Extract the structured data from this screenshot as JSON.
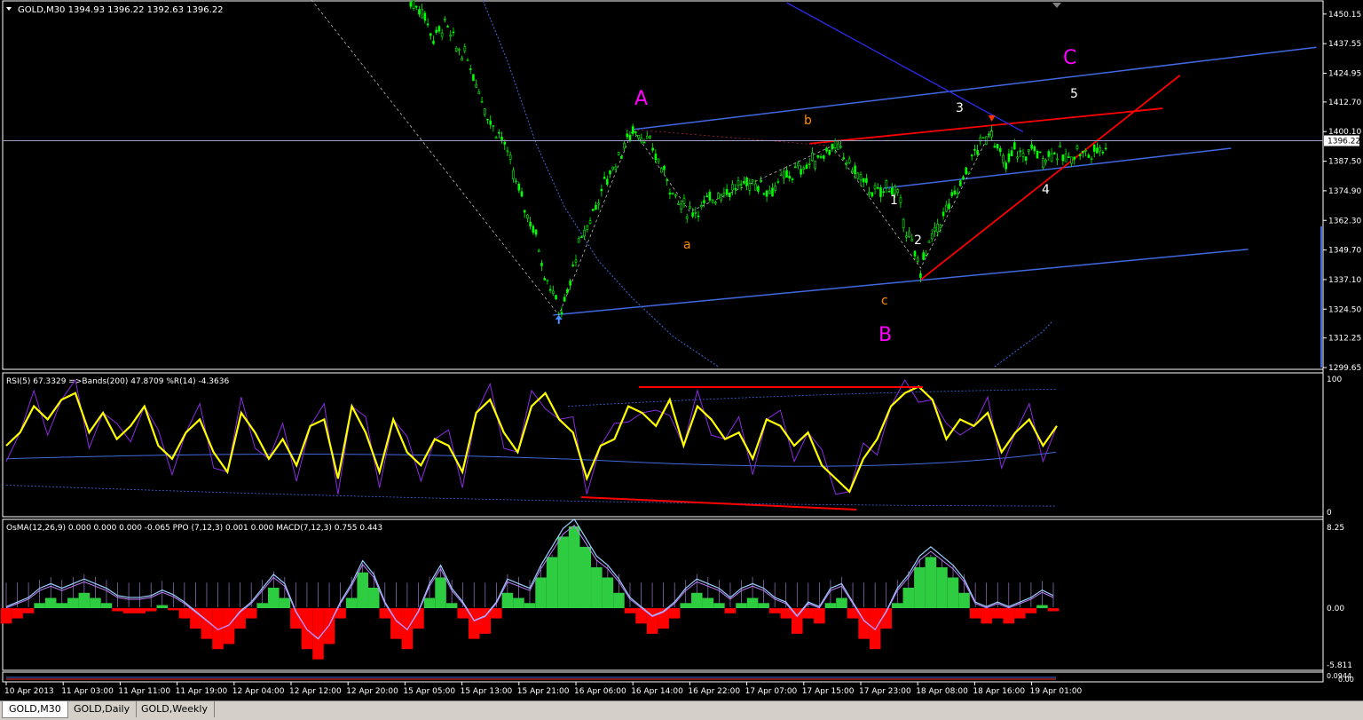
{
  "main_pane": {
    "title": "GOLD,M30  1394.93 1396.22 1392.63 1396.22",
    "current_price": "1396.22",
    "price_ticks": [
      "1450.15",
      "1437.55",
      "1424.95",
      "1412.70",
      "1400.10",
      "1387.50",
      "1374.90",
      "1362.30",
      "1349.70",
      "1337.10",
      "1324.50",
      "1312.25",
      "1299.65"
    ],
    "wave_labels": {
      "A": "A",
      "B": "B",
      "C": "C",
      "a": "a",
      "b": "b",
      "c": "c",
      "w1": "1",
      "w2": "2",
      "w3": "3",
      "w4": "4",
      "w5": "5"
    }
  },
  "rsi_pane": {
    "title": "RSI(5) 67.3329  =>Bands(200) 47.8709  %R(14) -4.3636",
    "ticks": [
      "100",
      "0"
    ]
  },
  "osma_pane": {
    "title": "OsMA(12,26,9) 0.000 0.000 0.000 -0.065  PPO (7,12,3) 0.001 0.000  MACD(7,12,3) 0.755 0.443",
    "ticks": [
      "8.25",
      "0.00",
      "-5.811"
    ]
  },
  "mini_pane": {
    "ticks": [
      "0.0944",
      "0.00"
    ]
  },
  "time_axis": [
    "10 Apr 2013",
    "11 Apr 03:00",
    "11 Apr 11:00",
    "11 Apr 19:00",
    "12 Apr 04:00",
    "12 Apr 12:00",
    "12 Apr 20:00",
    "15 Apr 05:00",
    "15 Apr 13:00",
    "15 Apr 21:00",
    "16 Apr 06:00",
    "16 Apr 14:00",
    "16 Apr 22:00",
    "17 Apr 07:00",
    "17 Apr 15:00",
    "17 Apr 23:00",
    "18 Apr 08:00",
    "18 Apr 16:00",
    "19 Apr 01:00"
  ],
  "tabs": [
    "GOLD,M30",
    "GOLD,Daily",
    "GOLD,Weekly"
  ],
  "colors": {
    "background": "#000000",
    "candles": "#00ff00",
    "wave_major": "#ff00ff",
    "wave_minor": "#ff8c00",
    "channel": "#4169e1",
    "trend_red": "#ff0000",
    "rsi": "#ffff00",
    "percent_r": "#8a2be2",
    "osma_pos": "#2ecc40",
    "osma_neg": "#ff0000"
  },
  "chart_data": {
    "type": "candlestick",
    "symbol": "GOLD",
    "timeframe": "M30",
    "ylim": [
      1299.65,
      1455
    ],
    "x_categories": [
      "10 Apr 2013",
      "11 Apr 03:00",
      "11 Apr 11:00",
      "11 Apr 19:00",
      "12 Apr 04:00",
      "12 Apr 12:00",
      "12 Apr 20:00",
      "15 Apr 05:00",
      "15 Apr 13:00",
      "15 Apr 21:00",
      "16 Apr 06:00",
      "16 Apr 14:00",
      "16 Apr 22:00",
      "17 Apr 07:00",
      "17 Apr 15:00",
      "17 Apr 23:00",
      "18 Apr 08:00",
      "18 Apr 16:00",
      "19 Apr 01:00"
    ],
    "close_path": [
      [
        7.1,
        1455
      ],
      [
        7.3,
        1452
      ],
      [
        7.5,
        1440
      ],
      [
        7.7,
        1446
      ],
      [
        7.9,
        1436
      ],
      [
        8.1,
        1431
      ],
      [
        8.3,
        1418
      ],
      [
        8.5,
        1404
      ],
      [
        8.7,
        1398
      ],
      [
        8.9,
        1382
      ],
      [
        9.1,
        1368
      ],
      [
        9.3,
        1356
      ],
      [
        9.45,
        1340
      ],
      [
        9.6,
        1332
      ],
      [
        9.7,
        1322
      ],
      [
        9.85,
        1330
      ],
      [
        10.0,
        1348
      ],
      [
        10.2,
        1360
      ],
      [
        10.5,
        1378
      ],
      [
        10.8,
        1392
      ],
      [
        11.0,
        1401
      ],
      [
        11.2,
        1398
      ],
      [
        11.4,
        1390
      ],
      [
        11.6,
        1380
      ],
      [
        11.8,
        1370
      ],
      [
        12.0,
        1366
      ],
      [
        12.2,
        1368
      ],
      [
        12.5,
        1374
      ],
      [
        12.8,
        1376
      ],
      [
        13.1,
        1379
      ],
      [
        13.4,
        1375
      ],
      [
        13.7,
        1381
      ],
      [
        14.0,
        1385
      ],
      [
        14.3,
        1390
      ],
      [
        14.5,
        1394
      ],
      [
        14.7,
        1390
      ],
      [
        14.9,
        1383
      ],
      [
        15.1,
        1377
      ],
      [
        15.3,
        1373
      ],
      [
        15.5,
        1378
      ],
      [
        15.65,
        1372
      ],
      [
        15.8,
        1359
      ],
      [
        15.95,
        1347
      ],
      [
        16.05,
        1342
      ],
      [
        16.2,
        1352
      ],
      [
        16.4,
        1362
      ],
      [
        16.6,
        1371
      ],
      [
        16.8,
        1380
      ],
      [
        17.0,
        1391
      ],
      [
        17.2,
        1398
      ],
      [
        17.3,
        1401
      ],
      [
        17.4,
        1392
      ],
      [
        17.55,
        1385
      ],
      [
        17.7,
        1393
      ],
      [
        17.85,
        1389
      ],
      [
        18.0,
        1393
      ],
      [
        18.2,
        1389
      ],
      [
        18.4,
        1392
      ],
      [
        18.6,
        1388
      ],
      [
        18.8,
        1392
      ],
      [
        19.0,
        1390
      ],
      [
        19.2,
        1393
      ],
      [
        19.35,
        1396.22
      ]
    ],
    "annotations": [
      {
        "label": "A",
        "x": 11.0,
        "y": 1401
      },
      {
        "label": "B",
        "x": 16.05,
        "y": 1342
      },
      {
        "label": "C",
        "x": 19.7,
        "y": 1436
      },
      {
        "label": "a",
        "x": 12.0,
        "y": 1366
      },
      {
        "label": "b",
        "x": 14.5,
        "y": 1394
      },
      {
        "label": "c",
        "x": 16.05,
        "y": 1342
      },
      {
        "label": "1",
        "x": 16.2,
        "y": 1375
      },
      {
        "label": "2",
        "x": 16.6,
        "y": 1356
      },
      {
        "label": "3",
        "x": 17.3,
        "y": 1401
      },
      {
        "label": "4",
        "x": 18.8,
        "y": 1376
      },
      {
        "label": "5",
        "x": 19.55,
        "y": 1419
      }
    ],
    "rsi": {
      "ylim": [
        0,
        100
      ],
      "values": [
        50,
        60,
        80,
        70,
        85,
        90,
        60,
        75,
        55,
        65,
        80,
        50,
        40,
        60,
        70,
        45,
        30,
        75,
        60,
        40,
        55,
        35,
        65,
        70,
        25,
        80,
        60,
        30,
        70,
        45,
        35,
        55,
        50,
        30,
        75,
        85,
        60,
        45,
        80,
        90,
        70,
        60,
        25,
        50,
        55,
        80,
        75,
        65,
        85,
        50,
        80,
        70,
        55,
        60,
        40,
        70,
        65,
        50,
        60,
        35,
        25,
        15,
        40,
        55,
        80,
        90,
        95,
        85,
        55,
        70,
        65,
        75,
        45,
        60,
        70,
        50,
        65
      ]
    },
    "osma": {
      "ylim": [
        -5.811,
        8.25
      ],
      "histogram": [
        -1.5,
        -1,
        -0.5,
        0.5,
        1,
        0.5,
        1,
        1.5,
        1,
        0.5,
        -0.3,
        -0.5,
        -0.5,
        -0.3,
        0.3,
        -0.2,
        -1,
        -2,
        -3,
        -4,
        -3.5,
        -2,
        -1,
        0.5,
        2,
        1,
        -2,
        -4,
        -5,
        -3.5,
        -1,
        1,
        3.5,
        2,
        -1,
        -3,
        -4,
        -2,
        1,
        3,
        0.5,
        -1,
        -3,
        -2.5,
        -1,
        1.5,
        1,
        0.5,
        3,
        5,
        7,
        8,
        6,
        4,
        3,
        1.5,
        -0.5,
        -1.5,
        -2.5,
        -2,
        -1,
        0.5,
        1.5,
        1,
        0.5,
        -0.5,
        0.5,
        1,
        0.5,
        -0.5,
        -1,
        -2.5,
        -1,
        -1.5,
        0.5,
        1,
        -1,
        -3,
        -4,
        -2,
        0.5,
        2,
        4,
        5,
        4,
        3,
        1.5,
        -1,
        -1.5,
        -1,
        -1.5,
        -1,
        -0.5,
        0.3,
        -0.3
      ]
    }
  }
}
